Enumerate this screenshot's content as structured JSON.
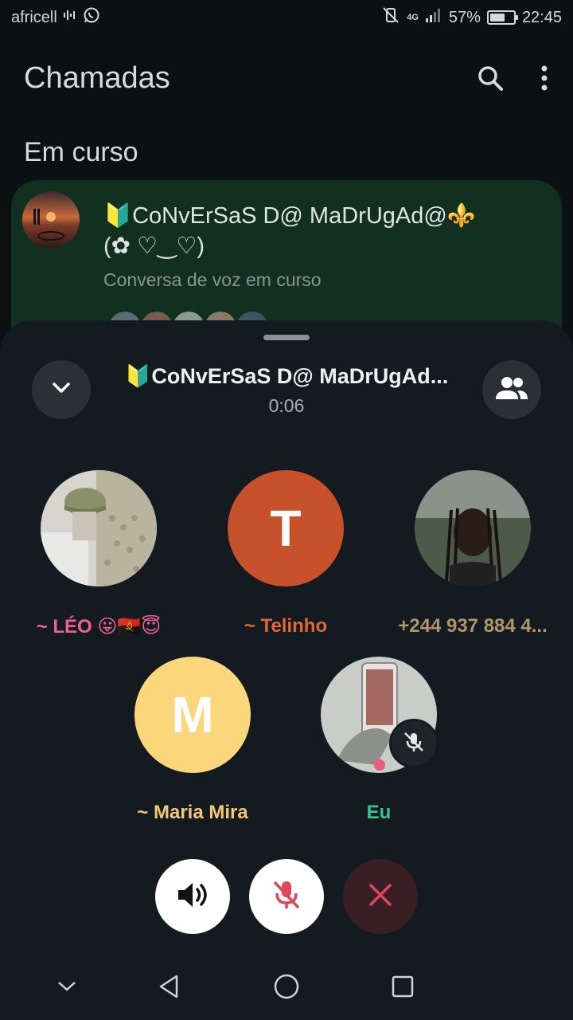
{
  "status_bar": {
    "carrier": "africell",
    "network": "4G",
    "battery_percent": "57%",
    "time": "22:45"
  },
  "header": {
    "title": "Chamadas",
    "search_icon": "search-icon",
    "more_icon": "more-vert-icon"
  },
  "ongoing": {
    "section_title": "Em curso",
    "group_name_line1": "🔰CoNvErSaS D@ MaDrUgAd@⚜️",
    "group_name_line2": "(✿ ♡‿♡)",
    "subtitle": "Conversa de voz em curso"
  },
  "call_sheet": {
    "title": "🔰CoNvErSaS D@ MaDrUgAd...",
    "timer": "0:06",
    "participants": [
      {
        "name": "~  LÉO 😛🇦🇴😇",
        "color": "#f06292",
        "avatar": "photo"
      },
      {
        "name": "~ Telinho",
        "color": "#e0663a",
        "avatar_letter": "T",
        "avatar_color": "#c7512a"
      },
      {
        "name": "+244 937 884 4...",
        "color": "#b0946a",
        "avatar": "photo"
      },
      {
        "name": "~ Maria Mira",
        "color": "#f4c874",
        "avatar_letter": "M",
        "avatar_color": "#fcd67b"
      },
      {
        "name": "Eu",
        "color": "#35c58a",
        "avatar": "photo",
        "muted": true
      }
    ]
  },
  "controls": {
    "speaker_icon": "speaker-icon",
    "mute_icon": "mic-off-icon",
    "end_icon": "close-icon"
  },
  "colors": {
    "background": "#0b1013",
    "card": "#11301f",
    "sheet": "#141b20",
    "accent_red": "#e0455a"
  }
}
